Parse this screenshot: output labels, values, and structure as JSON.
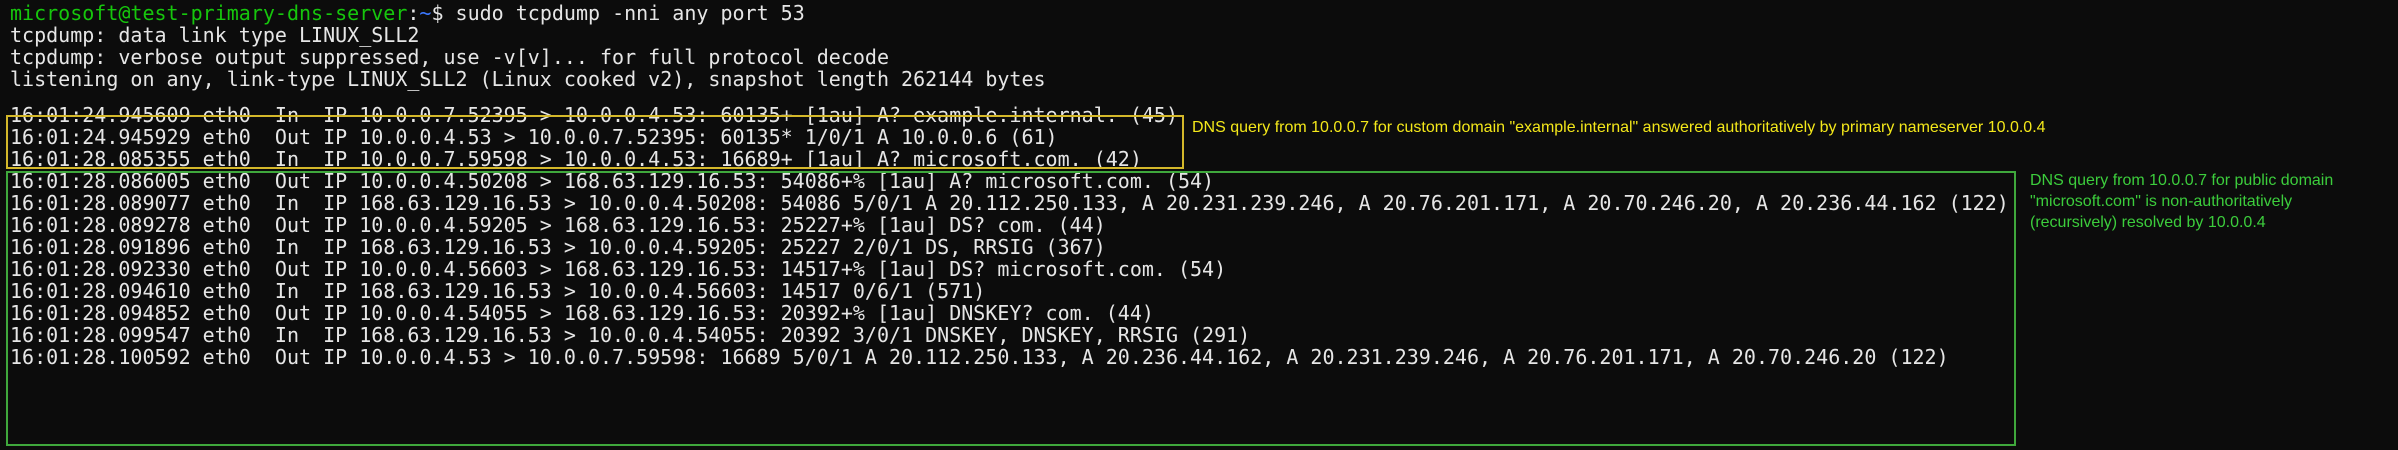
{
  "prompt": {
    "user_host": "microsoft@test-primary-dns-server",
    "colon": ":",
    "path": "~",
    "dollar": "$ ",
    "command": "sudo tcpdump -nni any port 53"
  },
  "header_lines": [
    "tcpdump: data link type LINUX_SLL2",
    "tcpdump: verbose output suppressed, use -v[v]... for full protocol decode",
    "listening on any, link-type LINUX_SLL2 (Linux cooked v2), snapshot length 262144 bytes"
  ],
  "packet_lines": [
    "16:01:24.945609 eth0  In  IP 10.0.0.7.52395 > 10.0.0.4.53: 60135+ [1au] A? example.internal. (45)",
    "16:01:24.945929 eth0  Out IP 10.0.0.4.53 > 10.0.0.7.52395: 60135* 1/0/1 A 10.0.0.6 (61)",
    "16:01:28.085355 eth0  In  IP 10.0.0.7.59598 > 10.0.0.4.53: 16689+ [1au] A? microsoft.com. (42)",
    "16:01:28.086005 eth0  Out IP 10.0.0.4.50208 > 168.63.129.16.53: 54086+% [1au] A? microsoft.com. (54)",
    "16:01:28.089077 eth0  In  IP 168.63.129.16.53 > 10.0.0.4.50208: 54086 5/0/1 A 20.112.250.133, A 20.231.239.246, A 20.76.201.171, A 20.70.246.20, A 20.236.44.162 (122)",
    "16:01:28.089278 eth0  Out IP 10.0.0.4.59205 > 168.63.129.16.53: 25227+% [1au] DS? com. (44)",
    "16:01:28.091896 eth0  In  IP 168.63.129.16.53 > 10.0.0.4.59205: 25227 2/0/1 DS, RRSIG (367)",
    "16:01:28.092330 eth0  Out IP 10.0.0.4.56603 > 168.63.129.16.53: 14517+% [1au] DS? microsoft.com. (54)",
    "16:01:28.094610 eth0  In  IP 168.63.129.16.53 > 10.0.0.4.56603: 14517 0/6/1 (571)",
    "16:01:28.094852 eth0  Out IP 10.0.0.4.54055 > 168.63.129.16.53: 20392+% [1au] DNSKEY? com. (44)",
    "16:01:28.099547 eth0  In  IP 168.63.129.16.53 > 10.0.0.4.54055: 20392 3/0/1 DNSKEY, DNSKEY, RRSIG (291)",
    "16:01:28.100592 eth0  Out IP 10.0.0.4.53 > 10.0.0.7.59598: 16689 5/0/1 A 20.112.250.133, A 20.236.44.162, A 20.231.239.246, A 20.76.201.171, A 20.70.246.20 (122)"
  ],
  "annotations": {
    "authoritative": "DNS query from 10.0.0.7 for custom domain \"example.internal\" answered authoritatively by primary nameserver 10.0.0.4",
    "recursive": [
      "DNS query from 10.0.0.7 for public domain",
      "\"microsoft.com\" is non-authoritatively",
      "(recursively) resolved by 10.0.0.4"
    ]
  },
  "colors": {
    "background": "#0c0c0c",
    "prompt_user": "#16c60c",
    "prompt_path": "#3b78ff",
    "annotation_yellow": "#f4e81a",
    "annotation_green": "#3ccd3c"
  }
}
